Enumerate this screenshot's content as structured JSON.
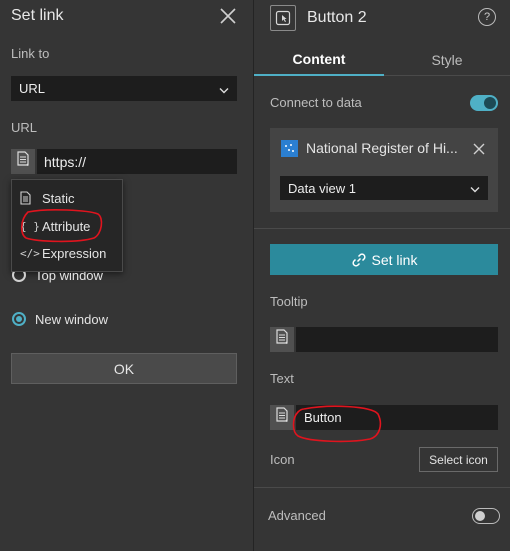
{
  "left_panel": {
    "title": "Set link",
    "link_to_label": "Link to",
    "link_to_value": "URL",
    "url_label": "URL",
    "url_value": "https://",
    "menu_items": [
      {
        "label": "Static",
        "icon": "document-icon"
      },
      {
        "label": "Attribute",
        "icon": "curly-braces-icon"
      },
      {
        "label": "Expression",
        "icon": "code-icon"
      }
    ],
    "radio_top": "Top window",
    "radio_new": "New window",
    "selected_radio": "New window",
    "ok_label": "OK"
  },
  "right_panel": {
    "title": "Button 2",
    "help": "?",
    "tabs": [
      {
        "label": "Content",
        "active": true
      },
      {
        "label": "Style",
        "active": false
      }
    ],
    "connect_label": "Connect to data",
    "connect_enabled": true,
    "datasource_name": "National Register of Hi...",
    "dataview": "Data view 1",
    "setlink_label": "Set link",
    "tooltip_label": "Tooltip",
    "tooltip_value": "",
    "text_label": "Text",
    "text_value": "Button",
    "icon_label": "Icon",
    "select_icon_label": "Select icon",
    "advanced_label": "Advanced",
    "advanced_enabled": false
  },
  "colors": {
    "accent": "#4fb0c6",
    "button_primary": "#2b8a9c",
    "panel_bg": "#353535",
    "input_bg": "#1d1d1d",
    "annotation": "#e0141e"
  }
}
